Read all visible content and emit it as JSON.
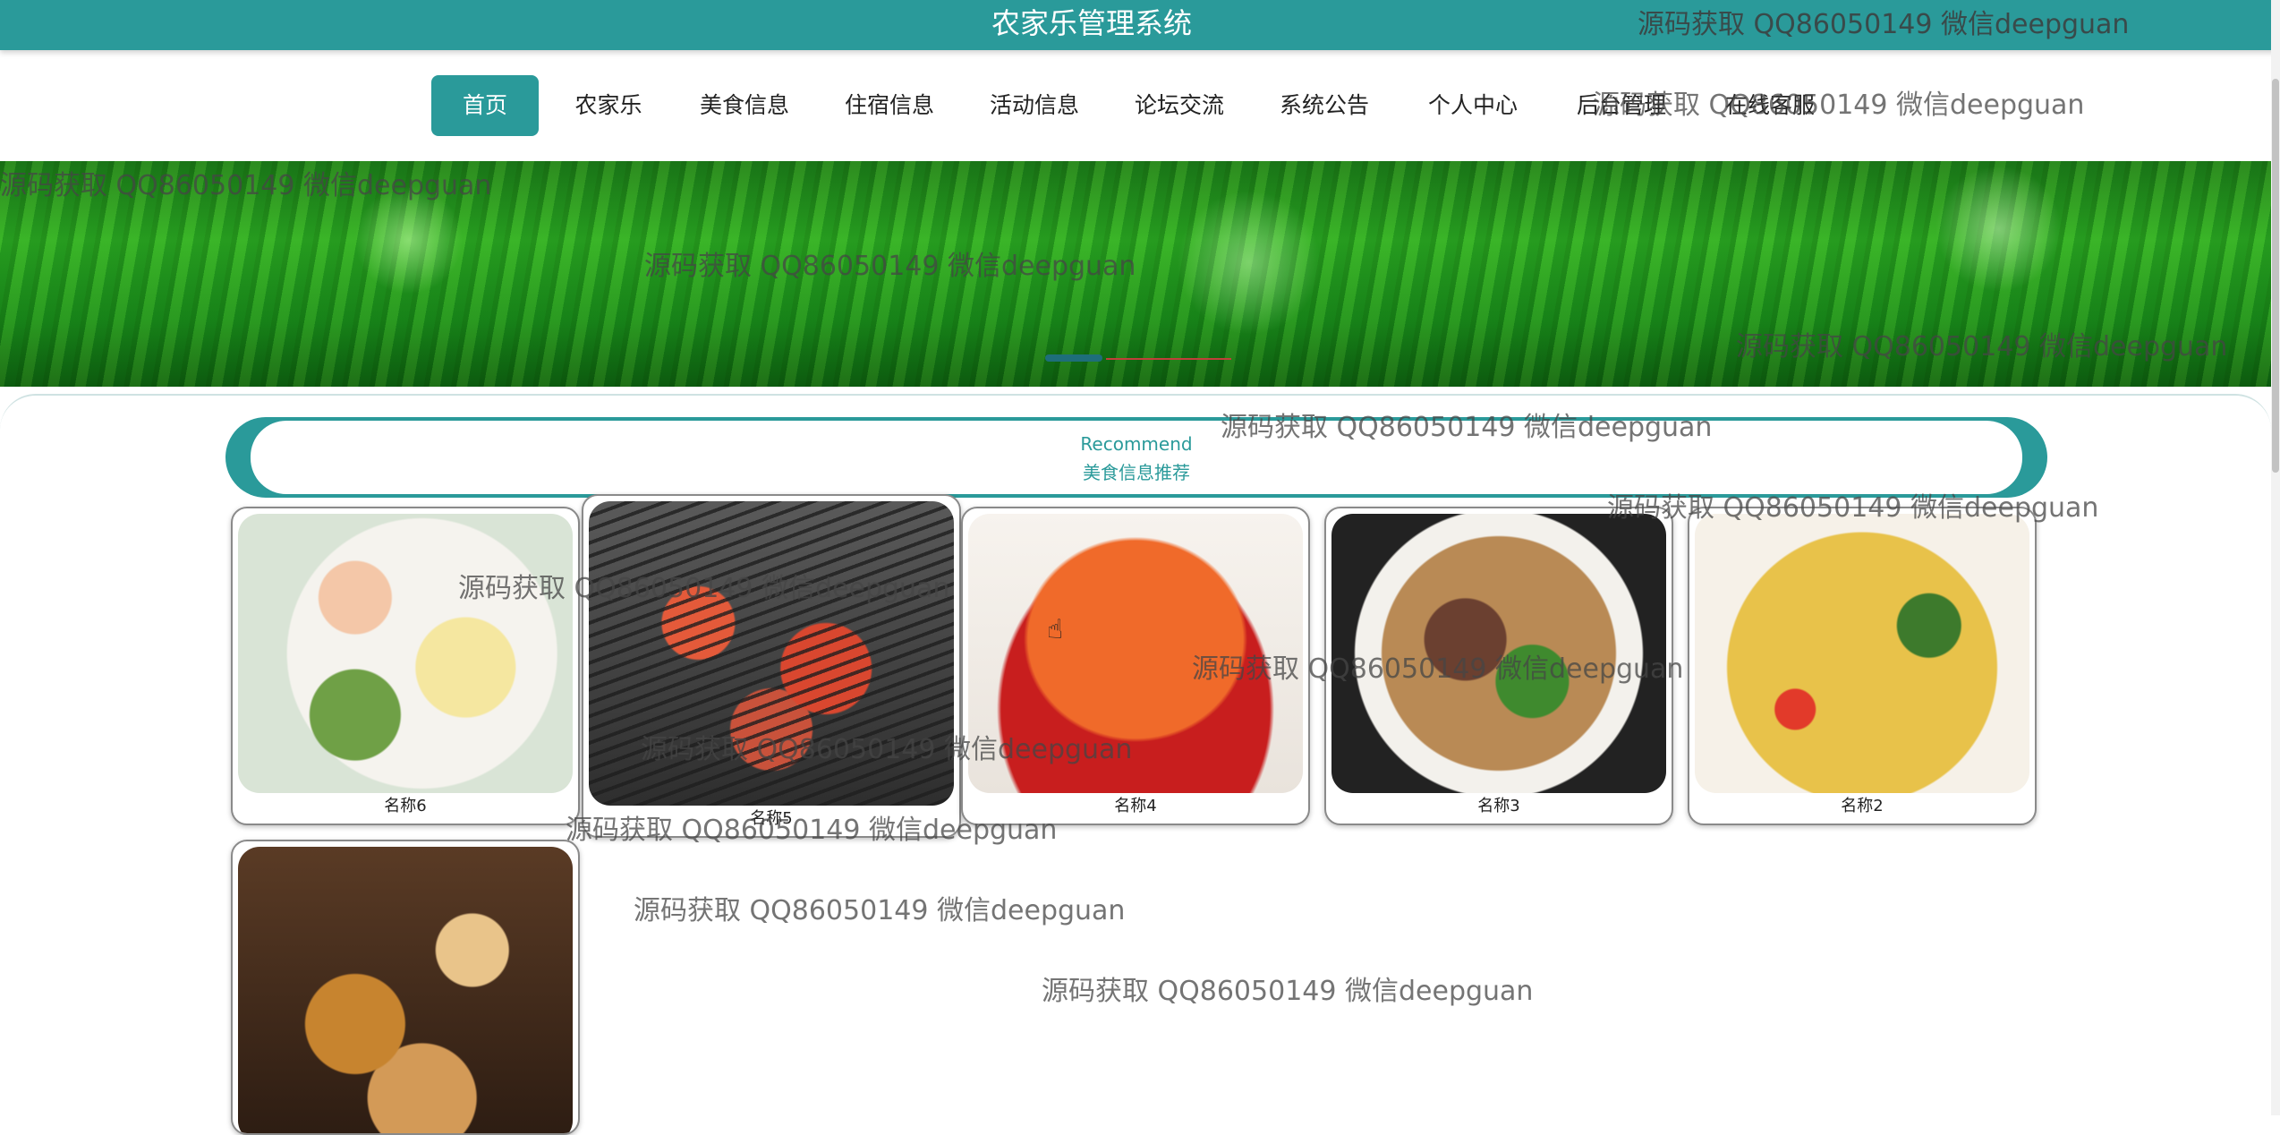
{
  "app_title": "农家乐管理系统",
  "nav": [
    {
      "label": "首页",
      "active": true
    },
    {
      "label": "农家乐"
    },
    {
      "label": "美食信息"
    },
    {
      "label": "住宿信息"
    },
    {
      "label": "活动信息"
    },
    {
      "label": "论坛交流"
    },
    {
      "label": "系统公告"
    },
    {
      "label": "个人中心"
    },
    {
      "label": "后台管理"
    },
    {
      "label": "在线客服"
    }
  ],
  "recommend": {
    "en": "Recommend",
    "cn": "美食信息推荐"
  },
  "foods": [
    {
      "name": "名称6"
    },
    {
      "name": "名称5"
    },
    {
      "name": "名称4"
    },
    {
      "name": "名称3"
    },
    {
      "name": "名称2"
    },
    {
      "name": ""
    }
  ],
  "watermark": "源码获取 QQ86050149 微信deepguan",
  "colors": {
    "accent": "#2a9a9a",
    "banner": "#2fae24"
  }
}
